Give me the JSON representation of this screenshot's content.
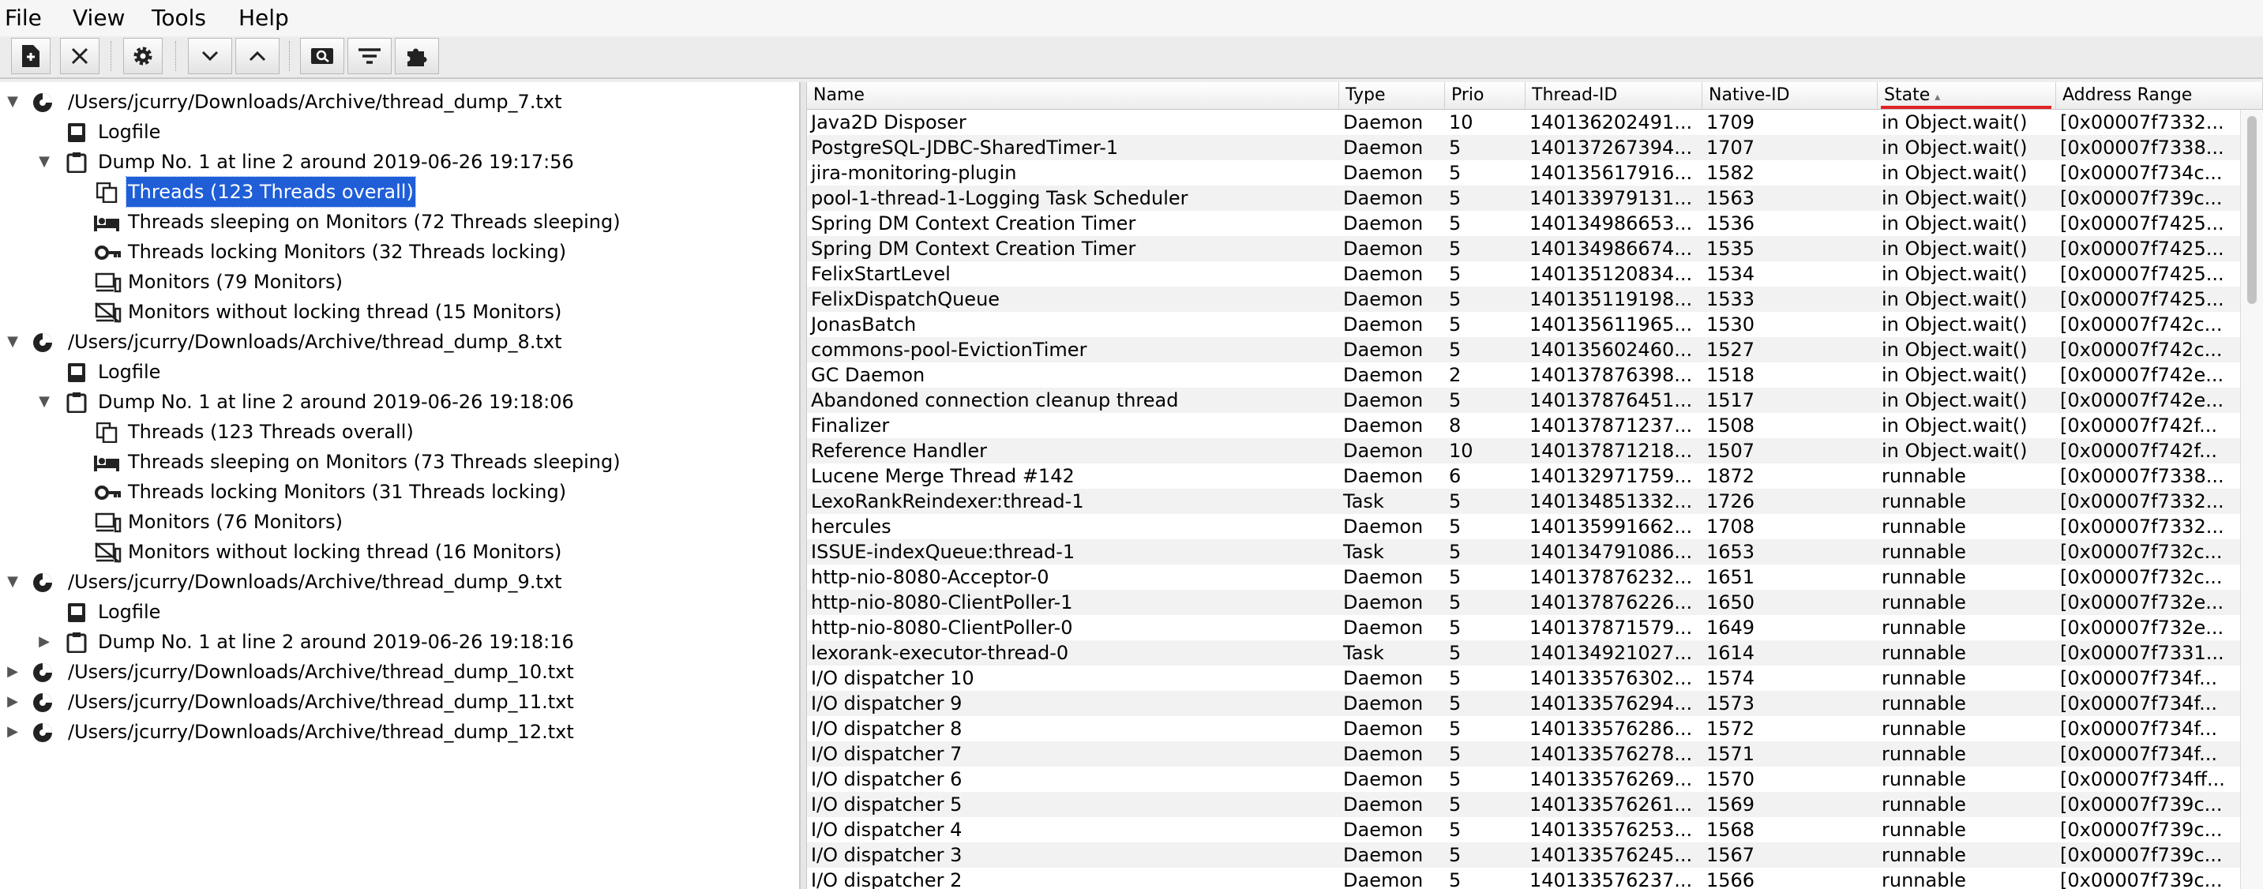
{
  "menu": [
    "File",
    "View",
    "Tools",
    "Help"
  ],
  "toolbar": {
    "buttons": [
      "open-file-icon",
      "close-icon",
      "settings-icon",
      "chevron-down-icon",
      "chevron-up-icon",
      "find-icon",
      "filter-icon",
      "plugin-icon"
    ]
  },
  "tree": {
    "nodes": [
      {
        "label": "/Users/jcurry/Downloads/Archive/thread_dump_7.txt",
        "depth": 0,
        "expanded": true,
        "icon": "dump-file-icon"
      },
      {
        "label": "Logfile",
        "depth": 1,
        "icon": "logfile-icon"
      },
      {
        "label": "Dump No. 1 at line 2 around 2019-06-26 19:17:56",
        "depth": 1,
        "expanded": true,
        "icon": "clipboard-icon"
      },
      {
        "label": "Threads (123 Threads overall)",
        "depth": 2,
        "icon": "threads-icon",
        "selected": true
      },
      {
        "label": "Threads sleeping on Monitors (72 Threads sleeping)",
        "depth": 2,
        "icon": "bed-icon"
      },
      {
        "label": "Threads locking Monitors (32 Threads locking)",
        "depth": 2,
        "icon": "key-icon"
      },
      {
        "label": "Monitors (79 Monitors)",
        "depth": 2,
        "icon": "monitor-icon"
      },
      {
        "label": "Monitors without locking thread (15 Monitors)",
        "depth": 2,
        "icon": "monitor-crossed-icon"
      },
      {
        "label": "/Users/jcurry/Downloads/Archive/thread_dump_8.txt",
        "depth": 0,
        "expanded": true,
        "icon": "dump-file-icon"
      },
      {
        "label": "Logfile",
        "depth": 1,
        "icon": "logfile-icon"
      },
      {
        "label": "Dump No. 1 at line 2 around 2019-06-26 19:18:06",
        "depth": 1,
        "expanded": true,
        "icon": "clipboard-icon"
      },
      {
        "label": "Threads (123 Threads overall)",
        "depth": 2,
        "icon": "threads-icon"
      },
      {
        "label": "Threads sleeping on Monitors (73 Threads sleeping)",
        "depth": 2,
        "icon": "bed-icon"
      },
      {
        "label": "Threads locking Monitors (31 Threads locking)",
        "depth": 2,
        "icon": "key-icon"
      },
      {
        "label": "Monitors (76 Monitors)",
        "depth": 2,
        "icon": "monitor-icon"
      },
      {
        "label": "Monitors without locking thread (16 Monitors)",
        "depth": 2,
        "icon": "monitor-crossed-icon"
      },
      {
        "label": "/Users/jcurry/Downloads/Archive/thread_dump_9.txt",
        "depth": 0,
        "expanded": true,
        "icon": "dump-file-icon"
      },
      {
        "label": "Logfile",
        "depth": 1,
        "icon": "logfile-icon"
      },
      {
        "label": "Dump No. 1 at line 2 around 2019-06-26 19:18:16",
        "depth": 1,
        "expanded": false,
        "icon": "clipboard-icon"
      },
      {
        "label": "/Users/jcurry/Downloads/Archive/thread_dump_10.txt",
        "depth": 0,
        "expanded": false,
        "icon": "dump-file-icon"
      },
      {
        "label": "/Users/jcurry/Downloads/Archive/thread_dump_11.txt",
        "depth": 0,
        "expanded": false,
        "icon": "dump-file-icon"
      },
      {
        "label": "/Users/jcurry/Downloads/Archive/thread_dump_12.txt",
        "depth": 0,
        "expanded": false,
        "icon": "dump-file-icon"
      }
    ]
  },
  "table": {
    "columns": [
      "Name",
      "Type",
      "Prio",
      "Thread-ID",
      "Native-ID",
      "State",
      "Address Range"
    ],
    "sorted_column": "State",
    "sort_indicator_color": "#e02222",
    "rows": [
      [
        "Java2D Disposer",
        "Daemon",
        "10",
        "140136202491...",
        "1709",
        "in Object.wait()",
        "[0x00007f7332..."
      ],
      [
        "PostgreSQL-JDBC-SharedTimer-1",
        "Daemon",
        "5",
        "140137267394...",
        "1707",
        "in Object.wait()",
        "[0x00007f7338..."
      ],
      [
        "jira-monitoring-plugin",
        "Daemon",
        "5",
        "140135617916...",
        "1582",
        "in Object.wait()",
        "[0x00007f734c..."
      ],
      [
        "pool-1-thread-1-Logging Task Scheduler",
        "Daemon",
        "5",
        "140133979131...",
        "1563",
        "in Object.wait()",
        "[0x00007f739c..."
      ],
      [
        "Spring DM Context Creation Timer",
        "Daemon",
        "5",
        "140134986653...",
        "1536",
        "in Object.wait()",
        "[0x00007f7425..."
      ],
      [
        "Spring DM Context Creation Timer",
        "Daemon",
        "5",
        "140134986674...",
        "1535",
        "in Object.wait()",
        "[0x00007f7425..."
      ],
      [
        "FelixStartLevel",
        "Daemon",
        "5",
        "140135120834...",
        "1534",
        "in Object.wait()",
        "[0x00007f7425..."
      ],
      [
        "FelixDispatchQueue",
        "Daemon",
        "5",
        "140135119198...",
        "1533",
        "in Object.wait()",
        "[0x00007f7425..."
      ],
      [
        "JonasBatch",
        "Daemon",
        "5",
        "140135611965...",
        "1530",
        "in Object.wait()",
        "[0x00007f742c..."
      ],
      [
        "commons-pool-EvictionTimer",
        "Daemon",
        "5",
        "140135602460...",
        "1527",
        "in Object.wait()",
        "[0x00007f742c..."
      ],
      [
        "GC Daemon",
        "Daemon",
        "2",
        "140137876398...",
        "1518",
        "in Object.wait()",
        "[0x00007f742e..."
      ],
      [
        "Abandoned connection cleanup thread",
        "Daemon",
        "5",
        "140137876451...",
        "1517",
        "in Object.wait()",
        "[0x00007f742e..."
      ],
      [
        "Finalizer",
        "Daemon",
        "8",
        "140137871237...",
        "1508",
        "in Object.wait()",
        "[0x00007f742f..."
      ],
      [
        "Reference Handler",
        "Daemon",
        "10",
        "140137871218...",
        "1507",
        "in Object.wait()",
        "[0x00007f742f..."
      ],
      [
        "Lucene Merge Thread #142",
        "Daemon",
        "6",
        "140132971759...",
        "1872",
        "runnable",
        "[0x00007f7338..."
      ],
      [
        "LexoRankReindexer:thread-1",
        "Task",
        "5",
        "140134851332...",
        "1726",
        "runnable",
        "[0x00007f7332..."
      ],
      [
        "hercules",
        "Daemon",
        "5",
        "140135991662...",
        "1708",
        "runnable",
        "[0x00007f7332..."
      ],
      [
        "ISSUE-indexQueue:thread-1",
        "Task",
        "5",
        "140134791086...",
        "1653",
        "runnable",
        "[0x00007f732c..."
      ],
      [
        "http-nio-8080-Acceptor-0",
        "Daemon",
        "5",
        "140137876232...",
        "1651",
        "runnable",
        "[0x00007f732c..."
      ],
      [
        "http-nio-8080-ClientPoller-1",
        "Daemon",
        "5",
        "140137876226...",
        "1650",
        "runnable",
        "[0x00007f732e..."
      ],
      [
        "http-nio-8080-ClientPoller-0",
        "Daemon",
        "5",
        "140137871579...",
        "1649",
        "runnable",
        "[0x00007f732e..."
      ],
      [
        "lexorank-executor-thread-0",
        "Task",
        "5",
        "140134921027...",
        "1614",
        "runnable",
        "[0x00007f7331..."
      ],
      [
        "I/O dispatcher 10",
        "Daemon",
        "5",
        "140133576302...",
        "1574",
        "runnable",
        "[0x00007f734f..."
      ],
      [
        "I/O dispatcher 9",
        "Daemon",
        "5",
        "140133576294...",
        "1573",
        "runnable",
        "[0x00007f734f..."
      ],
      [
        "I/O dispatcher 8",
        "Daemon",
        "5",
        "140133576286...",
        "1572",
        "runnable",
        "[0x00007f734f..."
      ],
      [
        "I/O dispatcher 7",
        "Daemon",
        "5",
        "140133576278...",
        "1571",
        "runnable",
        "[0x00007f734f..."
      ],
      [
        "I/O dispatcher 6",
        "Daemon",
        "5",
        "140133576269...",
        "1570",
        "runnable",
        "[0x00007f734ff..."
      ],
      [
        "I/O dispatcher 5",
        "Daemon",
        "5",
        "140133576261...",
        "1569",
        "runnable",
        "[0x00007f739c..."
      ],
      [
        "I/O dispatcher 4",
        "Daemon",
        "5",
        "140133576253...",
        "1568",
        "runnable",
        "[0x00007f739c..."
      ],
      [
        "I/O dispatcher 3",
        "Daemon",
        "5",
        "140133576245...",
        "1567",
        "runnable",
        "[0x00007f739c..."
      ],
      [
        "I/O dispatcher 2",
        "Daemon",
        "5",
        "140133576237...",
        "1566",
        "runnable",
        "[0x00007f739c..."
      ]
    ]
  }
}
